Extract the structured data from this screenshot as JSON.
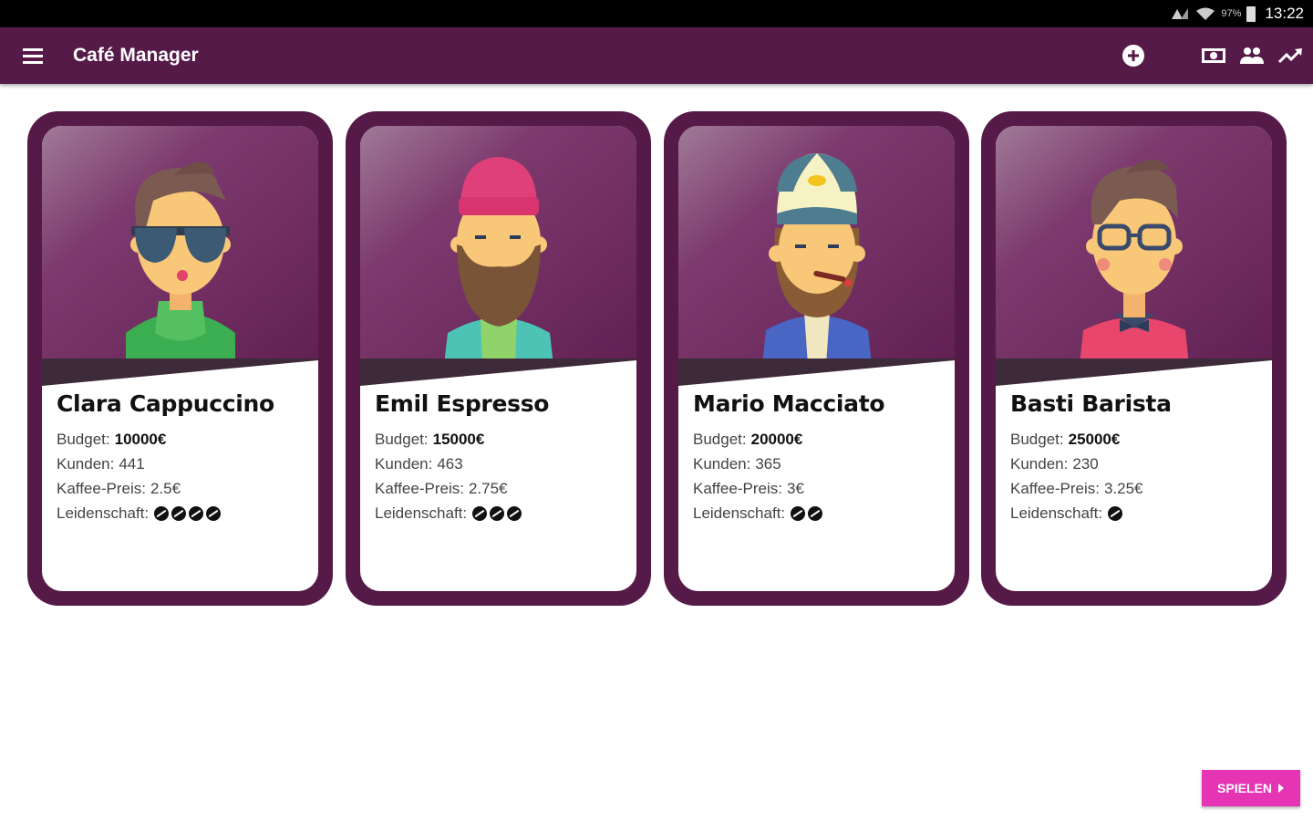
{
  "status": {
    "battery": "97%",
    "time": "13:22"
  },
  "app": {
    "title": "Café Manager"
  },
  "toolbar": {
    "menu_icon": "menu-icon",
    "actions": [
      "add-circle-icon",
      "money-icon",
      "people-icon",
      "trending-up-icon"
    ]
  },
  "labels": {
    "budget": "Budget:",
    "customers": "Kunden:",
    "price": "Kaffee-Preis:",
    "passion": "Leidenschaft:"
  },
  "characters": [
    {
      "name": "Clara Cappuccino",
      "budget": "10000€",
      "customers": "441",
      "price": "2.5€",
      "passion": 4
    },
    {
      "name": "Emil Espresso",
      "budget": "15000€",
      "customers": "463",
      "price": "2.75€",
      "passion": 3
    },
    {
      "name": "Mario Macciato",
      "budget": "20000€",
      "customers": "365",
      "price": "3€",
      "passion": 2
    },
    {
      "name": "Basti Barista",
      "budget": "25000€",
      "customers": "230",
      "price": "3.25€",
      "passion": 1
    }
  ],
  "play_button": {
    "label": "SPIELEN"
  },
  "colors": {
    "primary": "#561a48",
    "accent": "#e535b4"
  }
}
